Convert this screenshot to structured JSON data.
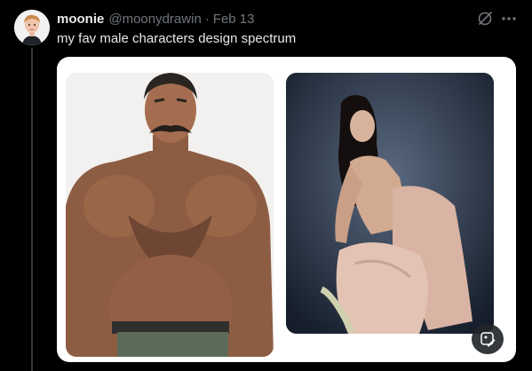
{
  "tweet": {
    "display_name": "moonie",
    "handle": "@moonydrawin",
    "separator": "·",
    "date": "Feb 13",
    "text": "my fav male characters design spectrum"
  },
  "icons": {
    "avatar": "avatar-portrait",
    "grok": "grok-slash-icon",
    "more": "more-dots-icon",
    "edit": "edit-image-icon"
  },
  "media": {
    "images": [
      {
        "subject": "muscular-mustached-man-shirtless"
      },
      {
        "subject": "slender-man-draped-satin-fabric"
      }
    ]
  },
  "colors": {
    "background": "#000000",
    "text_primary": "#e7e9ea",
    "text_secondary": "#71767b",
    "card_background": "#ffffff"
  }
}
